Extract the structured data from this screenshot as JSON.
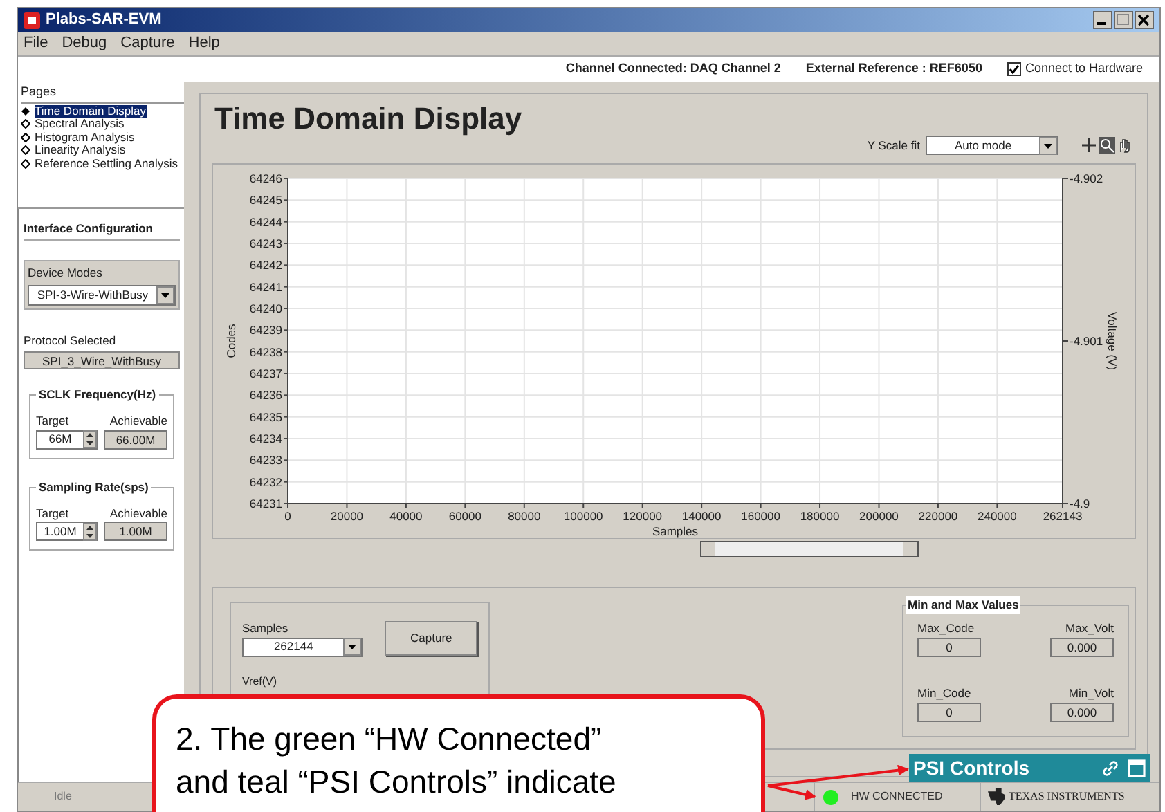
{
  "window": {
    "title": "Plabs-SAR-EVM"
  },
  "menu": [
    "File",
    "Debug",
    "Capture",
    "Help"
  ],
  "info_bar": {
    "channel": "Channel Connected: DAQ Channel 2",
    "reference": "External Reference : REF6050",
    "connect": {
      "label": "Connect to Hardware",
      "checked": true
    }
  },
  "pages": {
    "title": "Pages",
    "items": [
      {
        "label": "Time Domain Display",
        "selected": true
      },
      {
        "label": "Spectral Analysis",
        "selected": false
      },
      {
        "label": "Histogram Analysis",
        "selected": false
      },
      {
        "label": "Linearity Analysis",
        "selected": false
      },
      {
        "label": "Reference Settling Analysis",
        "selected": false
      }
    ]
  },
  "interface_configuration": {
    "title": "Interface Configuration",
    "device_modes": {
      "label": "Device Modes",
      "value": "SPI-3-Wire-WithBusy"
    },
    "protocol": {
      "label": "Protocol Selected",
      "value": "SPI_3_Wire_WithBusy"
    },
    "groups": [
      {
        "title": "SCLK Frequency(Hz)",
        "target_label": "Target",
        "target": "66M",
        "achievable_label": "Achievable",
        "achievable": "66.00M"
      },
      {
        "title": "Sampling Rate(sps)",
        "target_label": "Target",
        "target": "1.00M",
        "achievable_label": "Achievable",
        "achievable": "1.00M"
      }
    ]
  },
  "page_title": "Time Domain Display",
  "y_scale": {
    "label": "Y Scale fit",
    "value": "Auto mode"
  },
  "chart": {
    "chart_data": {
      "type": "line",
      "grid": true,
      "xlabel": "Samples",
      "ylabel": "Codes",
      "xlim": [
        0,
        262143
      ],
      "ylim": [
        64231,
        64246
      ],
      "xticks": [
        0,
        20000,
        40000,
        60000,
        80000,
        100000,
        120000,
        140000,
        160000,
        180000,
        200000,
        220000,
        240000,
        262143
      ],
      "yticks": [
        64231,
        64232,
        64233,
        64234,
        64235,
        64236,
        64237,
        64238,
        64239,
        64240,
        64241,
        64242,
        64243,
        64244,
        64245,
        64246
      ]
    },
    "right_axis": {
      "label": "Voltage (V)",
      "ticks": [
        "-4.902",
        "-4.901",
        "-4.9"
      ]
    }
  },
  "sample_range": {
    "level": 1
  },
  "capture": {
    "samples_label": "Samples",
    "samples": "262144",
    "button": "Capture",
    "vref_label": "Vref(V)"
  },
  "min_max": {
    "title": "Min and Max Values",
    "fields": [
      {
        "label": "Max_Code",
        "value": "0"
      },
      {
        "label": "Max_Volt",
        "value": "0.000"
      },
      {
        "label": "Min_Code",
        "value": "0"
      },
      {
        "label": "Min_Volt",
        "value": "0.000"
      }
    ]
  },
  "psi_controls": {
    "label": "PSI Controls"
  },
  "status_bar": {
    "state": "Idle",
    "hardware": {
      "label": "HW CONNECTED",
      "connected": true
    },
    "logo": "TEXAS INSTRUMENTS"
  },
  "callout": {
    "text": "2. The green “HW Connected”\nand teal “PSI Controls” indicate"
  }
}
